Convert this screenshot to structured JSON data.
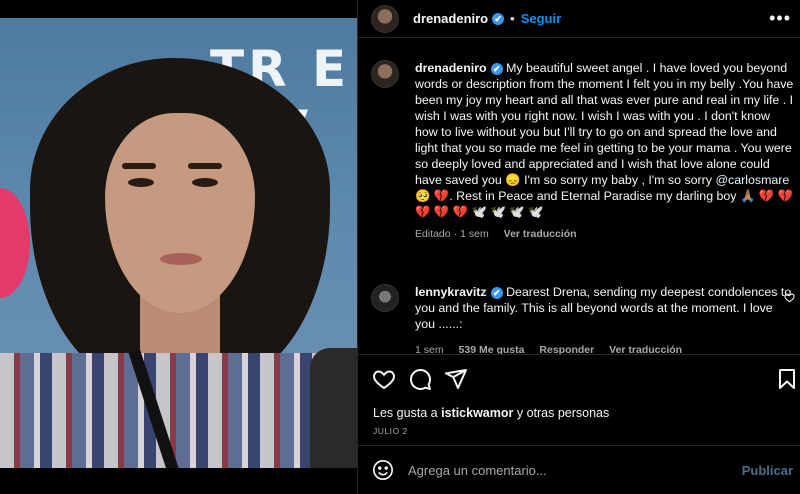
{
  "header": {
    "username": "drenadeniro",
    "verified_mark": "✔",
    "separator": "•",
    "follow_label": "Seguir",
    "more_icon": "more-horizontal-icon",
    "more_glyph": "•••"
  },
  "photo": {
    "backdrop_line1": "TR  E",
    "backdrop_line2": "T  V"
  },
  "caption": {
    "username": "drenadeniro",
    "text_before_mention": "My beautiful sweet angel . I have loved you beyond words or description from the moment I felt you in my belly .You have been my joy my heart and all that was ever pure and real in my life . I wish I was with you right now. I wish I was with you . I don't know how to live without you but I'll try to go on and spread the love and light that you so made me feel in getting to be your mama . You were so deeply loved and appreciated and I wish that love alone could have saved you 😞 I'm so sorry my baby , I'm so sorry",
    "mention": "@carlosmare",
    "text_after_mention": "🥺 💔. Rest in Peace and Eternal Paradise my darling boy 🙏🏽 💔 💔 💔 💔 💔 🕊️ 🕊️ 🕊️ 🕊️",
    "edited": "Editado",
    "dot": "·",
    "time": "1 sem",
    "translate": "Ver traducción"
  },
  "comment": {
    "username": "lennykravitz",
    "text": "Dearest Drena, sending my deepest condolences to you and the family. This is all beyond words at the moment. I love you ......:",
    "time": "1 sem",
    "likes": "539 Me gusta",
    "reply": "Responder",
    "translate": "Ver traducción"
  },
  "actions": {
    "like_icon": "heart-icon",
    "comment_icon": "comment-icon",
    "share_icon": "send-icon",
    "save_icon": "bookmark-icon"
  },
  "likes": {
    "prefix": "Les gusta a ",
    "user": "istickwamor",
    "suffix": " y otras personas"
  },
  "date": "JULIO 2",
  "add_comment": {
    "emoji_icon": "emoji-icon",
    "placeholder": "Agrega un comentario...",
    "publish_label": "Publicar"
  },
  "colors": {
    "accent": "#0095f6",
    "verified": "#3897f0",
    "background": "#000000",
    "muted": "#a8a8a8",
    "publish_disabled": "#4a6c8c"
  }
}
